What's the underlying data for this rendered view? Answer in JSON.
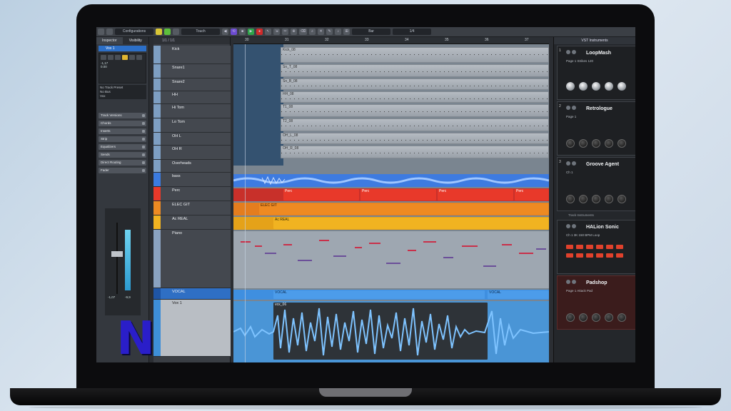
{
  "toolbar": {
    "config_label": "Configurations",
    "mode_label": "Touch",
    "quantize_label": "Bar",
    "grid_label": "1/4"
  },
  "inspector": {
    "tabs": [
      "Inspector",
      "Visibility"
    ],
    "track_name": "Vox 1",
    "values": [
      "-1,17",
      "0.00"
    ],
    "preset_list": [
      "No Track Preset",
      "No Bus",
      "Vox"
    ],
    "sections": [
      "Track Versions",
      "Chords",
      "Inserts",
      "Strip",
      "Equalizers",
      "Sends",
      "Direct Routing",
      "Fader"
    ],
    "fader_values": [
      "-1,07",
      "-9,9"
    ]
  },
  "tracklist": {
    "header": "1/1 / 1/1",
    "tracks": [
      "Kick",
      "Snare1",
      "Snare2",
      "HH",
      "Hi Tom",
      "Lo Tom",
      "OH L",
      "OH R",
      "Overheads",
      "bass",
      "Perc",
      "ELEC GIT",
      "Ac REAL",
      "Piano",
      "VOCAL",
      "Vox 1"
    ]
  },
  "arrange": {
    "ruler": [
      "30",
      "31",
      "32",
      "33",
      "34",
      "35",
      "36",
      "37"
    ],
    "clips": {
      "kick": "Kick_08",
      "snare1": "Sn_T_08",
      "snare2": "Sn_B_08",
      "hh": "HH_08",
      "hitom": "T1_08",
      "lotom": "T2_08",
      "ohl": "OH_L_08",
      "ohr": "OH_R_08",
      "perc": "Perc",
      "elec": "ELEC GIT",
      "acreal": "Ac REAL",
      "vocal": "VOCAL",
      "vox": "vox_06"
    }
  },
  "vst": {
    "header": "VST Instruments",
    "section_label": "Track Instruments",
    "instruments": [
      {
        "num": "1",
        "name": "LoopMash",
        "sub": "Page 1    Strikes 120"
      },
      {
        "num": "2",
        "name": "Retrologue",
        "sub": "Page 1"
      },
      {
        "num": "3",
        "name": "Groove Agent",
        "sub": "Ch 1"
      },
      {
        "num": "",
        "name": "HALion Sonic",
        "sub": "Ch 1    3K 150 BPM Loop"
      },
      {
        "num": "",
        "name": "Padshop",
        "sub": "Page 1    Attack Pad"
      }
    ]
  },
  "colors": {
    "accent_blue": "#2c6fc7",
    "perc_red": "#e8392a",
    "guitar_orange": "#ee8a22",
    "acreal_yellow": "#f1b321",
    "vocal_blue": "#4ba8e8",
    "logo_blue": "#2a1ec9"
  },
  "logo": "N"
}
